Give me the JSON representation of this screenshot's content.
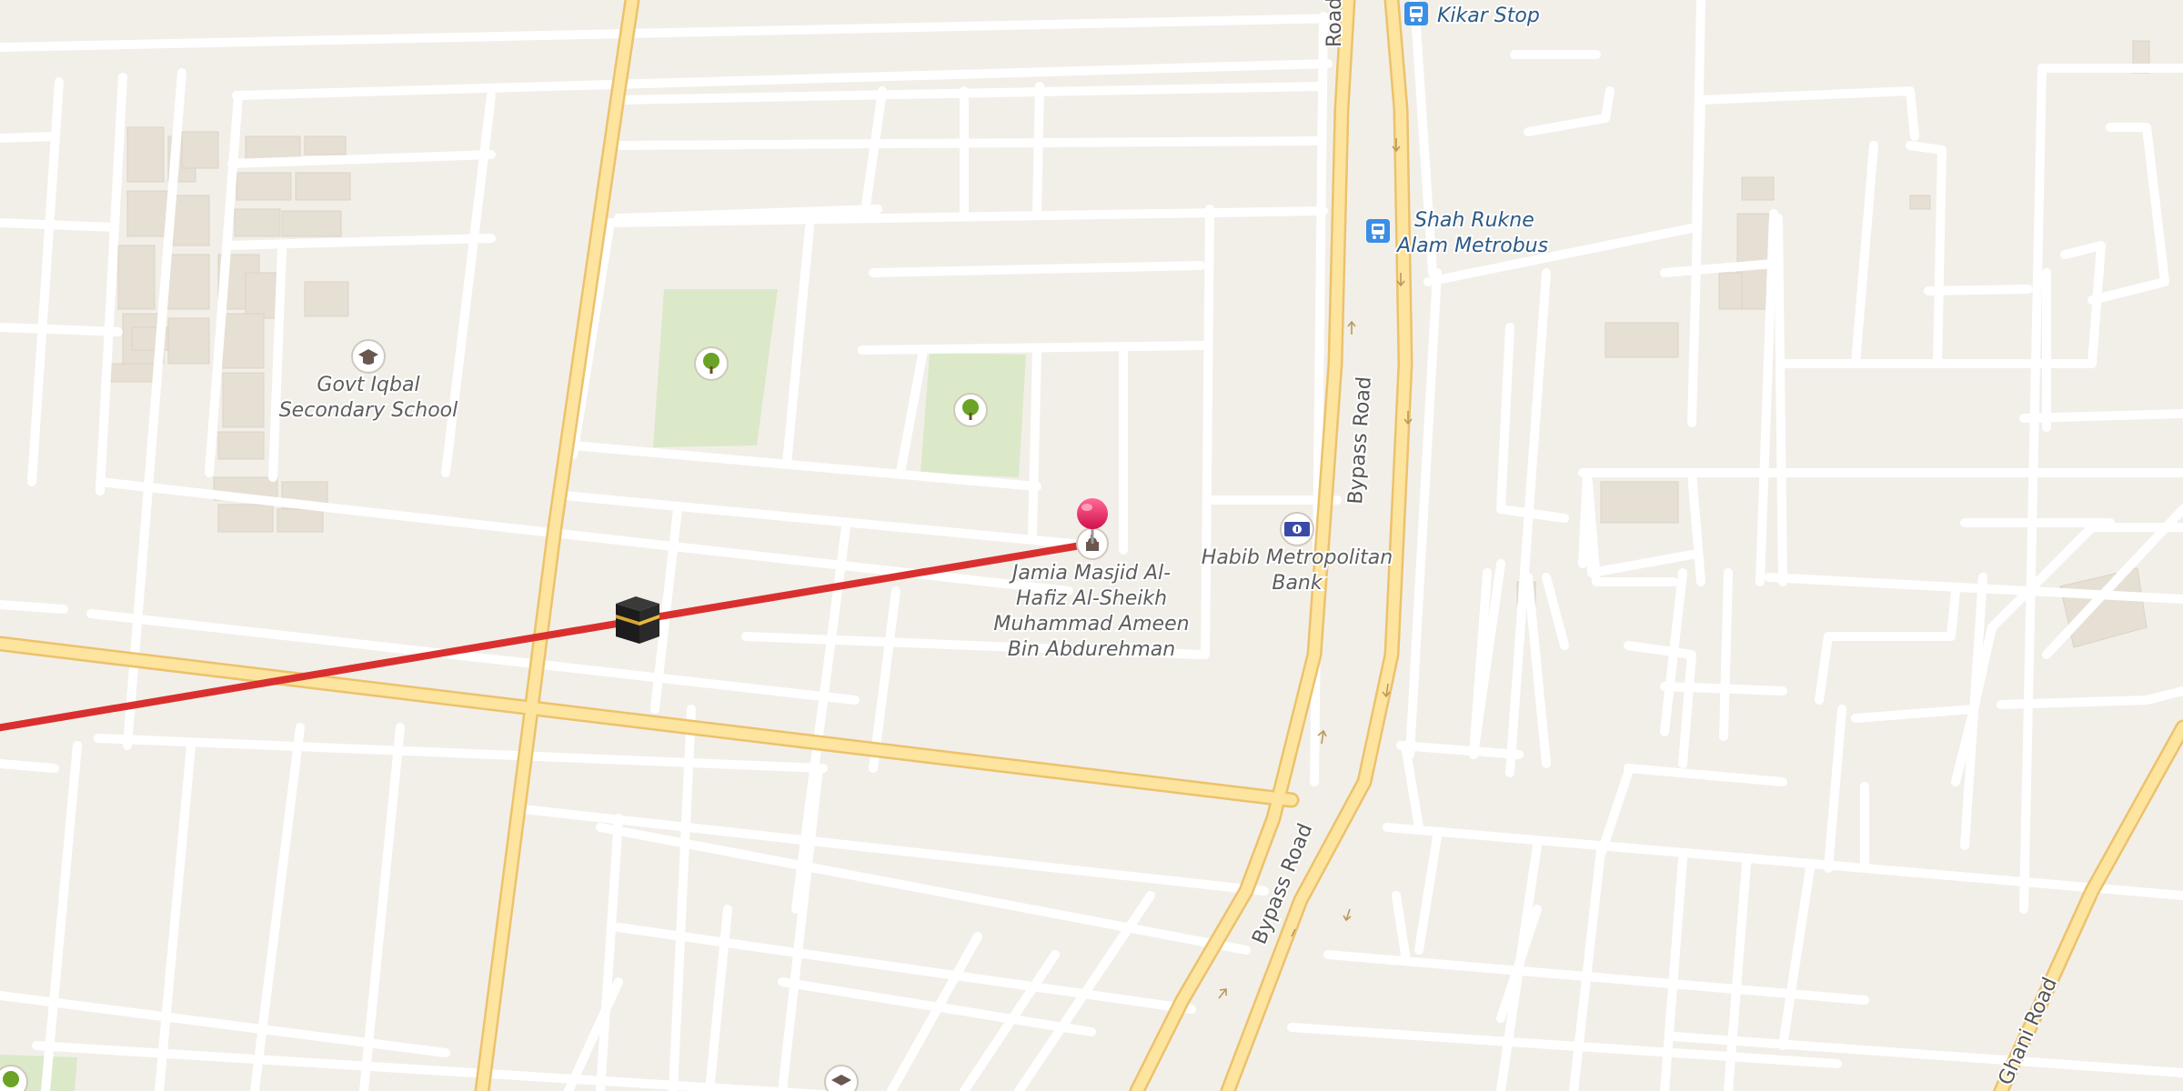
{
  "map": {
    "colors": {
      "background": "#f2efe9",
      "block": "#f6f4f1",
      "minor_road": "#ffffff",
      "major_road_fill": "#fde49f",
      "major_road_casing": "#ecc26c",
      "building": "#e8e1d8",
      "park": "#dbe9c8",
      "qibla_line": "#d9302f",
      "pin": "#e6195a",
      "transit_label": "#2c5a87",
      "poi_label": "#5e5e5e"
    },
    "road_labels": {
      "bypass_top": "Road",
      "bypass_mid": "Bypass Road",
      "bypass_low": "Bypass Road",
      "ghani": "Ghani Road"
    },
    "pois": {
      "kikar_stop": "Kikar Stop",
      "metrobus_line1": "Shah Rukne",
      "metrobus_line2": "Alam Metrobus",
      "school_line1": "Govt Iqbal",
      "school_line2": "Secondary School",
      "bank_line1": "Habib Metropolitan",
      "bank_line2": "Bank",
      "mosque_line1": "Jamia Masjid Al-",
      "mosque_line2": "Hafiz Al-Sheikh",
      "mosque_line3": "Muhammad Ameen",
      "mosque_line4": "Bin Abdurehman"
    },
    "icons": {
      "bus": "bus-stop-icon",
      "school": "school-icon",
      "park": "tree-icon",
      "bank": "bank-icon",
      "mosque": "mosque-icon",
      "kaaba": "kaaba-icon",
      "pin": "location-pin-icon"
    }
  }
}
